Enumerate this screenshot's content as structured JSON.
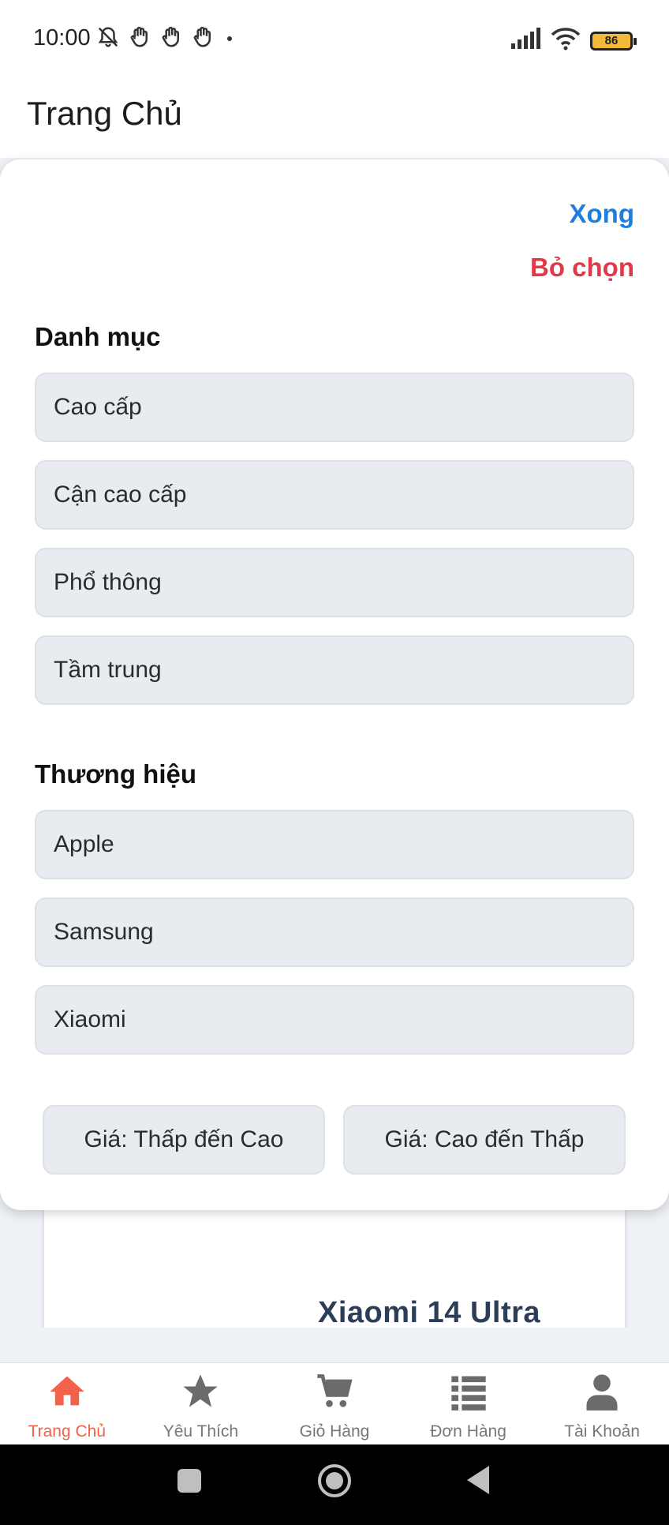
{
  "status_bar": {
    "time": "10:00",
    "battery": "86",
    "icons": [
      "mute-bell-icon",
      "hand-icon",
      "hand-icon",
      "hand-icon",
      "dot-icon",
      "signal-icon",
      "wifi-icon",
      "battery-icon"
    ]
  },
  "header": {
    "title": "Trang Chủ"
  },
  "filter_sheet": {
    "done_label": "Xong",
    "clear_label": "Bỏ chọn",
    "category_title": "Danh mục",
    "categories": [
      "Cao cấp",
      "Cận cao cấp",
      "Phổ thông",
      "Tầm trung"
    ],
    "brand_title": "Thương hiệu",
    "brands": [
      "Apple",
      "Samsung",
      "Xiaomi"
    ],
    "sort_low_high": "Giá: Thấp đến Cao",
    "sort_high_low": "Giá: Cao đến Thấp",
    "colors": {
      "done": "#1a7fe0",
      "clear": "#e0394a"
    }
  },
  "background_product": {
    "name": "Xiaomi 14 Ultra"
  },
  "bottom_nav": {
    "items": [
      {
        "label": "Trang Chủ",
        "icon": "home-icon",
        "active": true
      },
      {
        "label": "Yêu Thích",
        "icon": "star-icon",
        "active": false
      },
      {
        "label": "Giỏ Hàng",
        "icon": "cart-icon",
        "active": false
      },
      {
        "label": "Đơn Hàng",
        "icon": "list-icon",
        "active": false
      },
      {
        "label": "Tài Khoản",
        "icon": "user-icon",
        "active": false
      }
    ],
    "active_color": "#f2624a"
  }
}
